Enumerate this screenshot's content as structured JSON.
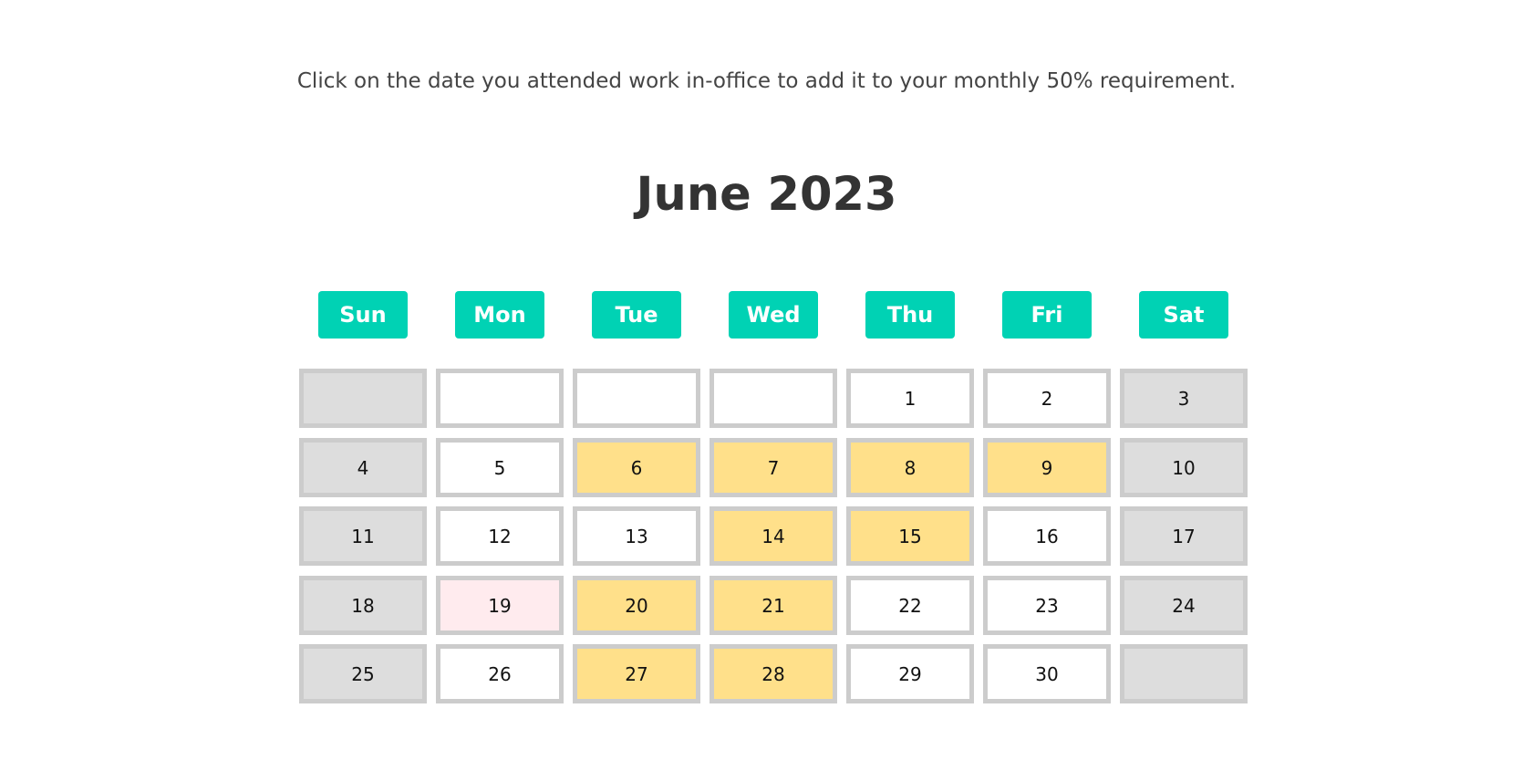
{
  "instructions": "Click on the date you attended work in-office to add it to your monthly 50% requirement.",
  "calendar": {
    "title": "June 2023",
    "weekdays": [
      "Sun",
      "Mon",
      "Tue",
      "Wed",
      "Thu",
      "Fri",
      "Sat"
    ],
    "colors": {
      "weekday_header": "#00d2b4",
      "attended": "#ffe08a",
      "weekend": "#dddddd",
      "highlight": "#ffebee",
      "workday": "#ffffff",
      "border": "#cccccc"
    },
    "weeks": [
      [
        {
          "label": "",
          "state": "weekend"
        },
        {
          "label": "",
          "state": "workday"
        },
        {
          "label": "",
          "state": "workday"
        },
        {
          "label": "",
          "state": "workday"
        },
        {
          "label": "1",
          "state": "workday"
        },
        {
          "label": "2",
          "state": "workday"
        },
        {
          "label": "3",
          "state": "weekend"
        }
      ],
      [
        {
          "label": "4",
          "state": "weekend"
        },
        {
          "label": "5",
          "state": "workday"
        },
        {
          "label": "6",
          "state": "attended"
        },
        {
          "label": "7",
          "state": "attended"
        },
        {
          "label": "8",
          "state": "attended"
        },
        {
          "label": "9",
          "state": "attended"
        },
        {
          "label": "10",
          "state": "weekend"
        }
      ],
      [
        {
          "label": "11",
          "state": "weekend"
        },
        {
          "label": "12",
          "state": "workday"
        },
        {
          "label": "13",
          "state": "workday"
        },
        {
          "label": "14",
          "state": "attended"
        },
        {
          "label": "15",
          "state": "attended"
        },
        {
          "label": "16",
          "state": "workday"
        },
        {
          "label": "17",
          "state": "weekend"
        }
      ],
      [
        {
          "label": "18",
          "state": "weekend"
        },
        {
          "label": "19",
          "state": "today"
        },
        {
          "label": "20",
          "state": "attended"
        },
        {
          "label": "21",
          "state": "attended"
        },
        {
          "label": "22",
          "state": "workday"
        },
        {
          "label": "23",
          "state": "workday"
        },
        {
          "label": "24",
          "state": "weekend"
        }
      ],
      [
        {
          "label": "25",
          "state": "weekend"
        },
        {
          "label": "26",
          "state": "workday"
        },
        {
          "label": "27",
          "state": "attended"
        },
        {
          "label": "28",
          "state": "attended"
        },
        {
          "label": "29",
          "state": "workday"
        },
        {
          "label": "30",
          "state": "workday"
        },
        {
          "label": "",
          "state": "weekend"
        }
      ]
    ]
  }
}
